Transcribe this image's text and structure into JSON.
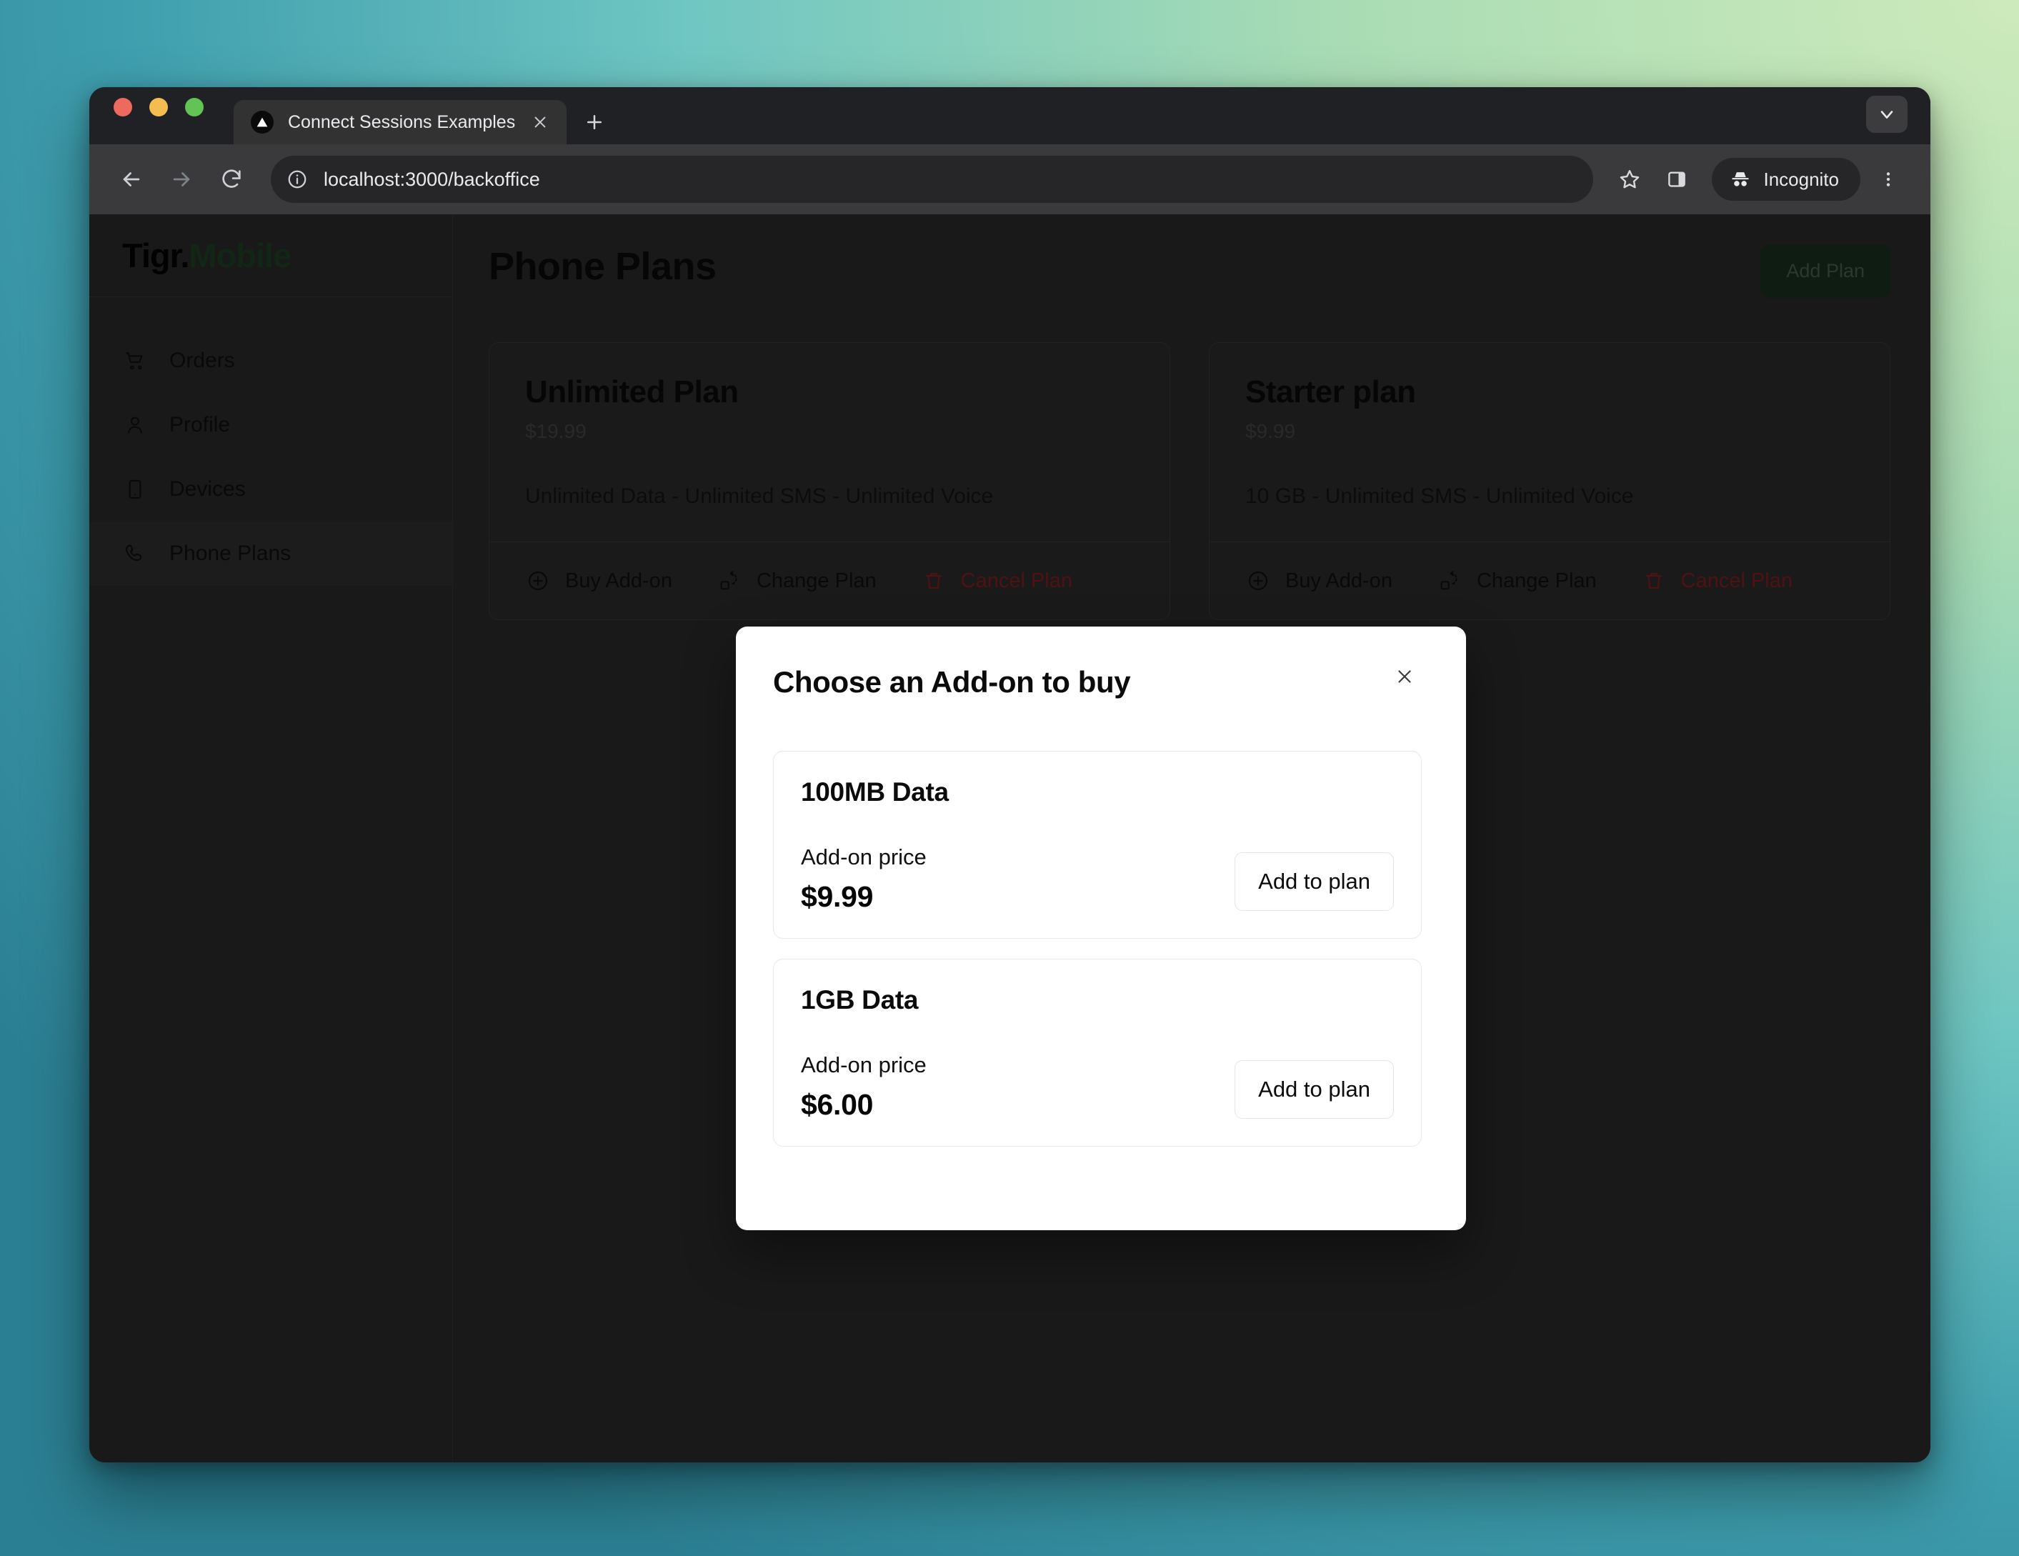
{
  "browser": {
    "tab": {
      "title": "Connect Sessions Examples",
      "close_label": "✕"
    },
    "new_tab_label": "+",
    "url": "localhost:3000/backoffice",
    "incognito_label": "Incognito"
  },
  "sidebar": {
    "brand_primary": "Tigr.",
    "brand_secondary": "Mobile",
    "items": [
      {
        "label": "Orders",
        "icon": "shopping-cart-icon",
        "active": false
      },
      {
        "label": "Profile",
        "icon": "user-icon",
        "active": false
      },
      {
        "label": "Devices",
        "icon": "tablet-icon",
        "active": false
      },
      {
        "label": "Phone Plans",
        "icon": "phone-icon",
        "active": true
      }
    ]
  },
  "main": {
    "page_title": "Phone Plans",
    "add_plan_label": "Add Plan",
    "plans": [
      {
        "name": "Unlimited Plan",
        "price": "$19.99",
        "features": "Unlimited Data - Unlimited SMS - Unlimited Voice",
        "actions": [
          {
            "label": "Buy Add-on",
            "icon": "plus-circle-icon",
            "danger": false
          },
          {
            "label": "Change Plan",
            "icon": "swap-icon",
            "danger": false
          },
          {
            "label": "Cancel Plan",
            "icon": "trash-icon",
            "danger": true
          }
        ]
      },
      {
        "name": "Starter plan",
        "price": "$9.99",
        "features": "10 GB - Unlimited SMS - Unlimited Voice",
        "actions": [
          {
            "label": "Buy Add-on",
            "icon": "plus-circle-icon",
            "danger": false
          },
          {
            "label": "Change Plan",
            "icon": "swap-icon",
            "danger": false
          },
          {
            "label": "Cancel Plan",
            "icon": "trash-icon",
            "danger": true
          }
        ]
      }
    ]
  },
  "modal": {
    "title": "Choose an Add-on to buy",
    "close_label": "✕",
    "addons": [
      {
        "name": "100MB Data",
        "price_label": "Add-on price",
        "price": "$9.99",
        "button_label": "Add to plan"
      },
      {
        "name": "1GB Data",
        "price_label": "Add-on price",
        "price": "$6.00",
        "button_label": "Add to plan"
      }
    ]
  },
  "colors": {
    "brand_green": "#1f4526",
    "danger_red": "#8e2222",
    "window_chrome": "#202124",
    "page_bg": "#2e2e2e"
  }
}
